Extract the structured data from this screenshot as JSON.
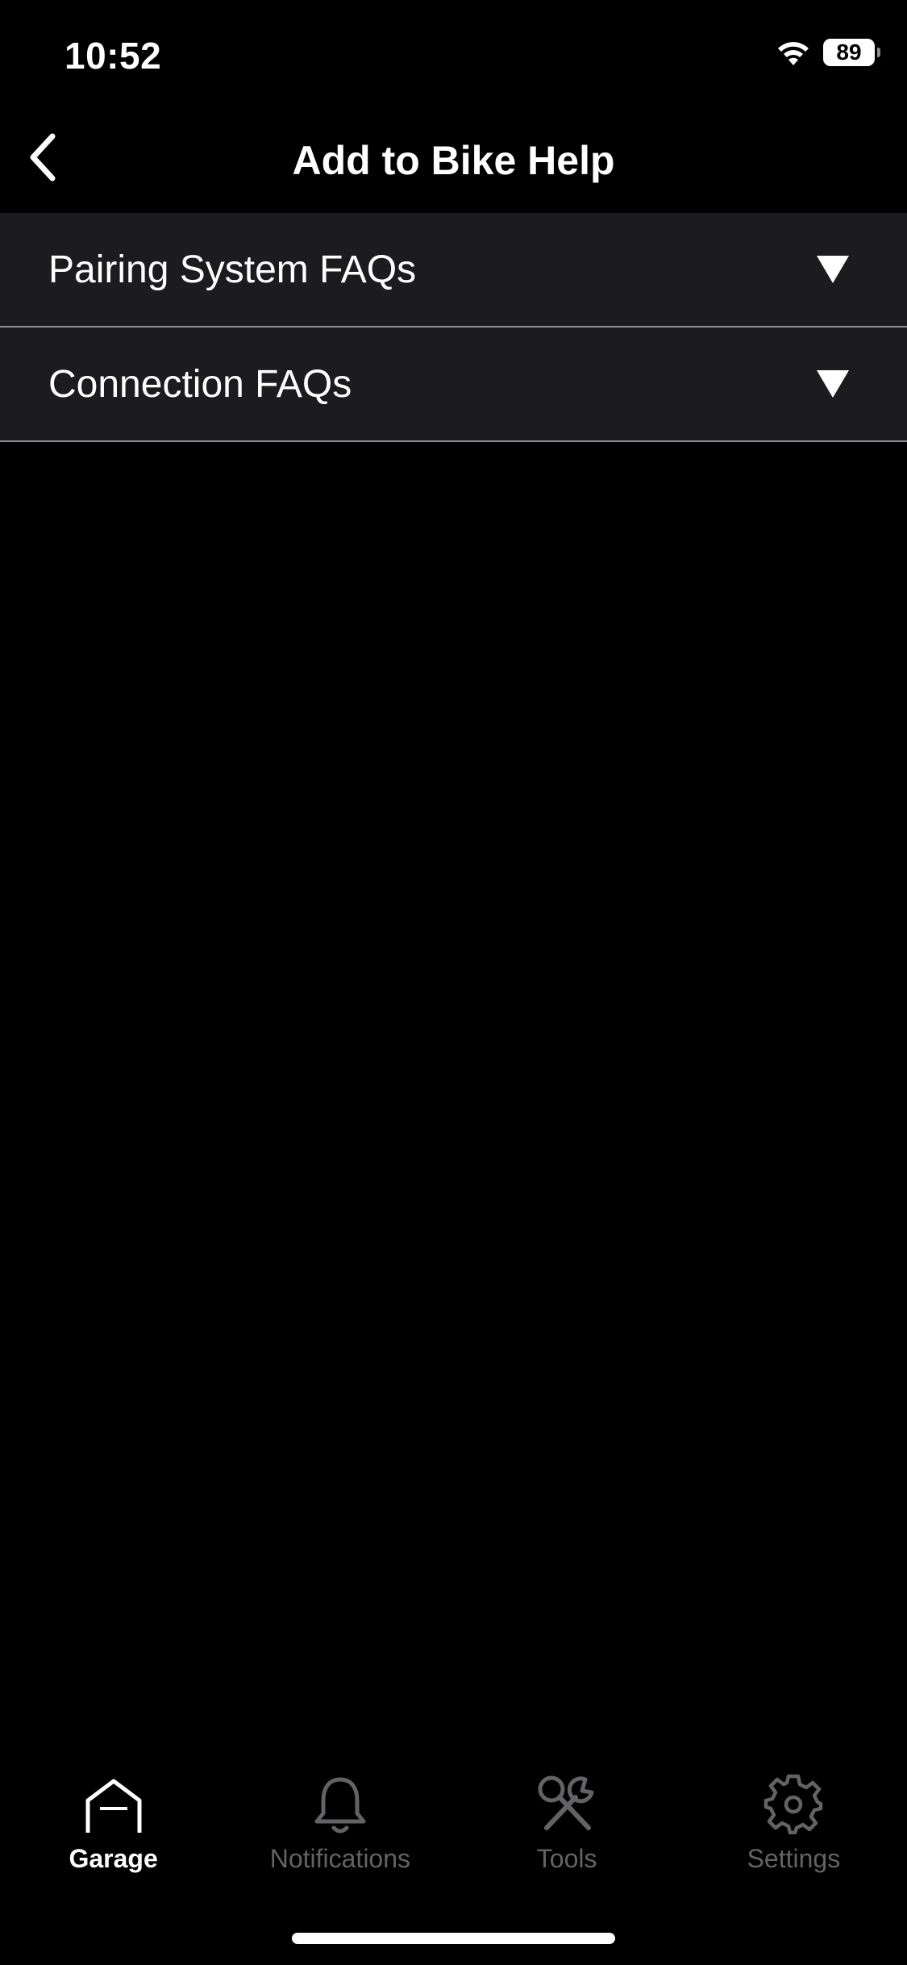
{
  "status_bar": {
    "time": "10:52",
    "battery": "89",
    "wifi_icon": "wifi-icon"
  },
  "nav": {
    "title": "Add to Bike Help",
    "back_icon": "chevron-left-icon"
  },
  "faq_sections": [
    {
      "label": "Pairing System FAQs",
      "icon": "triangle-down-icon",
      "expanded": false
    },
    {
      "label": "Connection FAQs",
      "icon": "triangle-down-icon",
      "expanded": false
    }
  ],
  "tab_bar": {
    "tabs": [
      {
        "label": "Garage",
        "icon": "garage-icon",
        "active": true
      },
      {
        "label": "Notifications",
        "icon": "bell-icon",
        "active": false
      },
      {
        "label": "Tools",
        "icon": "tools-icon",
        "active": false
      },
      {
        "label": "Settings",
        "icon": "gear-icon",
        "active": false
      }
    ]
  },
  "colors": {
    "background": "#000000",
    "row_background": "#1c1c1e",
    "divider": "#8e8e93",
    "text": "#ffffff",
    "inactive_tab": "#636366"
  }
}
